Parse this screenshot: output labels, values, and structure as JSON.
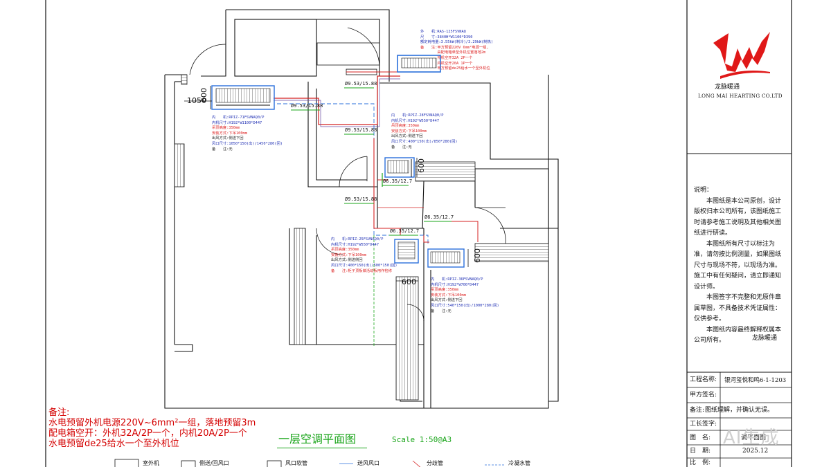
{
  "company": {
    "name_cn": "龙脉暖通",
    "name_en": "LONG MAI HEARTING CO.LTD"
  },
  "sidebar": {
    "heading": "说明：",
    "paragraphs": [
      "本图纸是本公司原创，设计版权归本公司所有，该图纸施工时请参考施工说明及其他相关图纸进行研读。",
      "本图纸所有尺寸以标注为准，请勿按比例测量，如果图纸尺寸与现场不符，以现场为准。施工中有任何疑问，请立即通知设计师。",
      "本图签字不完整和无原件章属草图，不具备技术凭证属性：仅供参考。",
      "本图纸内容最终解释权属本公司所有。"
    ],
    "signature": "龙脉暖通"
  },
  "title_block": {
    "rows": [
      {
        "label": "工程名称:",
        "value": "银河玺悦和鸣6-1-1203"
      },
      {
        "label": "甲方签名:",
        "value": ""
      },
      {
        "label": "备注:",
        "value": "图纸理解，并确认无误。"
      },
      {
        "label": "工长签字:",
        "value": ""
      },
      {
        "label": "图　名:",
        "value": "调平面图"
      },
      {
        "label": "日　期:",
        "value": "2025.12"
      },
      {
        "label": "比　例:",
        "value": ""
      }
    ]
  },
  "notes": {
    "heading": "备注:",
    "lines": [
      "水电预留外机电源220V~6mm²一组，落地预留3m",
      "配电箱空开：外机32A/2P一个，内机20A/2P一个",
      "水电预留de25给水一个至外机位"
    ]
  },
  "drawing_title": "一层空调平面图",
  "scale": "Scale 1:50@A3",
  "watermark": "AI生成",
  "legend": [
    "室外机",
    "侧送/回风口",
    "风口软管",
    "送风风口",
    "分歧管",
    "冷凝水管"
  ],
  "outdoor_unit": {
    "lines": [
      "外　　机:RAS-125FSVNAQ",
      "尺　　寸:3840H*W1100*D390",
      "额定耗电量:3.55kW(制冷)/3.29kW(制热)",
      "备　　注:甲方预留220V 6mm²电源一组,",
      "　　　　 由配电箱单至外机位置落地2m",
      "　　　　 外机空开32A 2P一个",
      "　　　　 内机空开20A 1P一个",
      "　　　　 甲方预留de25给水一个至外机位"
    ]
  },
  "indoor_units": [
    {
      "lines": [
        "内　　机:RPIZ-71FSVNAQ0/P",
        "内机尺寸:H192*W1100*D447",
        "吊顶高度:350mm",
        "安装方式:下吊100mm",
        "出风方式:侧送下回",
        "风口尺寸:1050*150(出)/1450*280(回)",
        "备　　注:无"
      ]
    },
    {
      "lines": [
        "内　　机:RPIZ-28FSVNAQ0/P",
        "内机尺寸:H192*W550*D447",
        "吊顶高度:350mm",
        "安装方式:下吊100mm",
        "出风方式:侧送下回",
        "风口尺寸:400*150(出)/850*280(回)",
        "备　　注:无"
      ]
    },
    {
      "lines": [
        "内　　机:RPIZ-25FSVNAQ0/P",
        "内机尺寸:H192*W550*D447",
        "吊顶高度:350mm",
        "安装方式:下吊100mm",
        "出风方式:侧送侧回",
        "风口尺寸:400*150(出)/500*150(回)",
        "备　　注:柜子顶板做活动板用作检修"
      ]
    },
    {
      "lines": [
        "内　　机:RPIZ-36FSVNAQ0/P",
        "内机尺寸:H192*W700*D447",
        "吊顶高度:350mm",
        "安装方式:下吊100mm",
        "出风方式:侧送下回",
        "风口尺寸:540*150(出)/1000*280(回)",
        "备　　注:无"
      ]
    }
  ],
  "pipe_labels": [
    "Ø9.53/15.88",
    "Ø9.53/15.88",
    "Ø9.53/15.88",
    "Ø9.53/15.88",
    "Ø6.35/12.7",
    "Ø6.35/12.7",
    "Ø6.35/12.7"
  ],
  "dimensions": [
    "1050",
    "600",
    "600",
    "600",
    "600"
  ],
  "colors": {
    "refrigerant": "#d42020",
    "condensate": "#2a6fdb",
    "annotation": "#1f2fb4",
    "brand": "#e01818",
    "title": "#19a319"
  }
}
